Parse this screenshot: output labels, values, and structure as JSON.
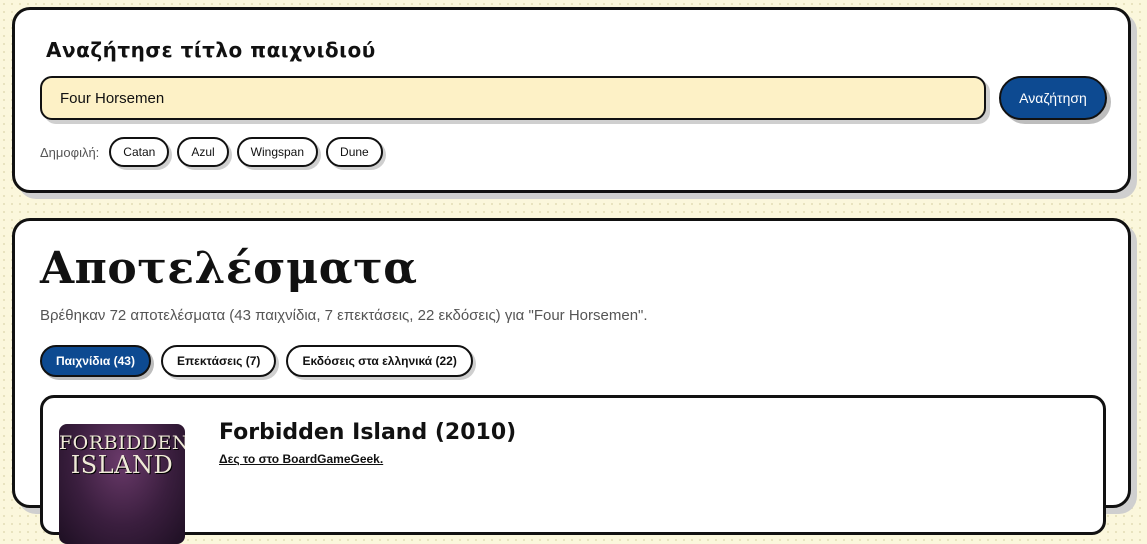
{
  "search": {
    "title": "Αναζήτησε τίτλο παιχνιδιού",
    "input_value": "Four Horsemen",
    "button_label": "Αναζήτηση",
    "popular_label": "Δημοφιλή:",
    "popular": [
      "Catan",
      "Azul",
      "Wingspan",
      "Dune"
    ]
  },
  "results": {
    "title": "Αποτελέσματα",
    "summary": "Βρέθηκαν 72 αποτελέσματα (43 παιχνίδια, 7 επεκτάσεις, 22 εκδόσεις) για \"Four Horsemen\".",
    "tabs": [
      "Παιχνίδια (43)",
      "Επεκτάσεις (7)",
      "Εκδόσεις στα ελληνικά (22)"
    ],
    "items": [
      {
        "title": "Forbidden Island (2010)",
        "link_label": "Δες το στο BoardGameGeek.",
        "cover_line1": "FORBIDDEN",
        "cover_line2": "ISLAND"
      }
    ]
  },
  "colors": {
    "accent": "#0d4a91",
    "input_bg": "#fdf1c6",
    "page_bg": "#fbf7dc"
  }
}
